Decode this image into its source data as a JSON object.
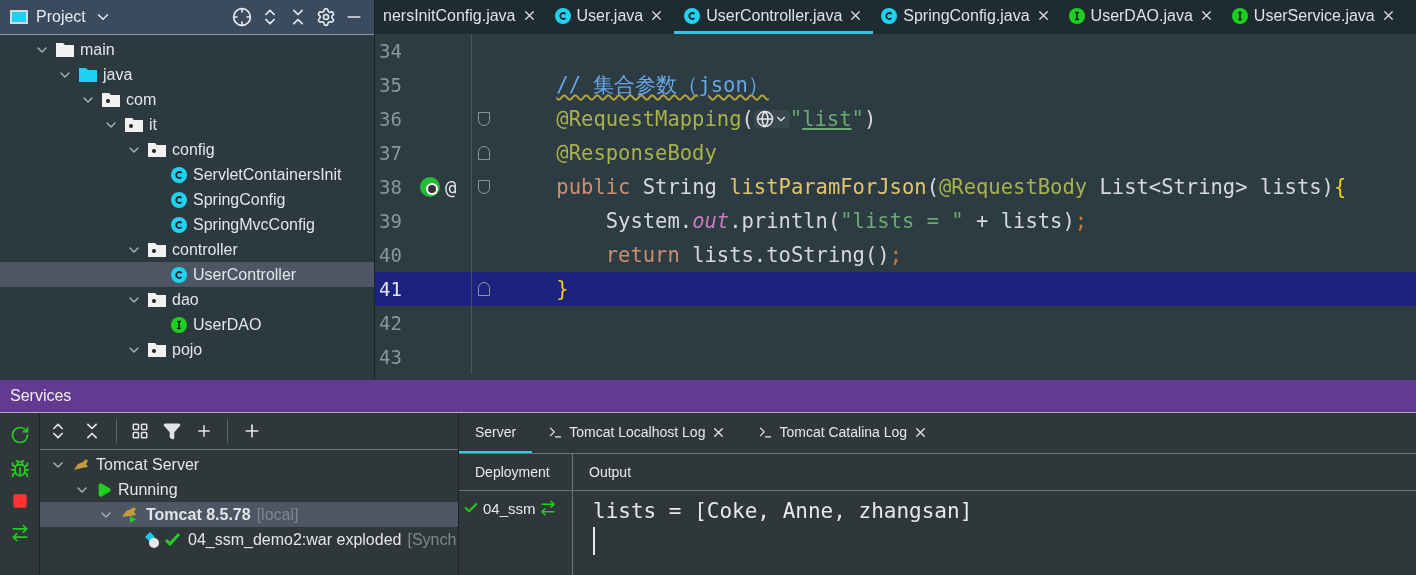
{
  "project_panel": {
    "title": "Project",
    "tree": [
      {
        "label": "main",
        "kind": "folder",
        "expanded": true,
        "selected": false,
        "children": [
          {
            "label": "java",
            "kind": "source-folder",
            "expanded": true,
            "selected": false,
            "children": [
              {
                "label": "com",
                "kind": "package",
                "expanded": true,
                "selected": false,
                "children": [
                  {
                    "label": "it",
                    "kind": "package",
                    "expanded": true,
                    "selected": false,
                    "children": [
                      {
                        "label": "config",
                        "kind": "package",
                        "expanded": true,
                        "selected": false,
                        "children": [
                          {
                            "label": "ServletContainersInit",
                            "kind": "class",
                            "selected": false
                          },
                          {
                            "label": "SpringConfig",
                            "kind": "class",
                            "selected": false
                          },
                          {
                            "label": "SpringMvcConfig",
                            "kind": "class",
                            "selected": false
                          }
                        ]
                      },
                      {
                        "label": "controller",
                        "kind": "package",
                        "expanded": true,
                        "selected": false,
                        "children": [
                          {
                            "label": "UserController",
                            "kind": "class",
                            "selected": true
                          }
                        ]
                      },
                      {
                        "label": "dao",
                        "kind": "package",
                        "expanded": true,
                        "selected": false,
                        "children": [
                          {
                            "label": "UserDAO",
                            "kind": "interface",
                            "selected": false
                          }
                        ]
                      },
                      {
                        "label": "pojo",
                        "kind": "package",
                        "expanded": true,
                        "selected": false
                      }
                    ]
                  }
                ]
              }
            ]
          }
        ]
      }
    ]
  },
  "editor_tabs": [
    {
      "label": "nersInitConfig.java",
      "kind": "none",
      "selected": false
    },
    {
      "label": "User.java",
      "kind": "class",
      "selected": false
    },
    {
      "label": "UserController.java",
      "kind": "class",
      "selected": true
    },
    {
      "label": "SpringConfig.java",
      "kind": "class",
      "selected": false
    },
    {
      "label": "UserDAO.java",
      "kind": "interface",
      "selected": false
    },
    {
      "label": "UserService.java",
      "kind": "interface",
      "selected": false
    }
  ],
  "editor": {
    "lines": [
      {
        "number": "34",
        "kind": "blank",
        "current": false,
        "fold_start": false,
        "fold_end": false
      },
      {
        "number": "35",
        "kind": "member",
        "current": false,
        "fold_start": false,
        "fold_end": false,
        "tokens": [
          {
            "text": "// 集合参数（json）",
            "kind": "comment"
          }
        ]
      },
      {
        "number": "36",
        "kind": "member",
        "current": false,
        "fold_start": true,
        "fold_end": false,
        "tokens": [
          {
            "text": "@RequestMapping",
            "kind": "annotation"
          },
          {
            "text": "(",
            "kind": "plain"
          },
          {
            "kind": "url-inlay"
          },
          {
            "text": "\"",
            "kind": "string"
          },
          {
            "text": "list",
            "kind": "string-link"
          },
          {
            "text": "\"",
            "kind": "string"
          },
          {
            "text": ")",
            "kind": "plain"
          }
        ]
      },
      {
        "number": "37",
        "kind": "member",
        "current": false,
        "fold_start": false,
        "fold_end": true,
        "tokens": [
          {
            "text": "@ResponseBody",
            "kind": "annotation"
          }
        ]
      },
      {
        "number": "38",
        "kind": "member",
        "current": false,
        "fold_start": true,
        "fold_end": false,
        "markers": true,
        "marker_text": "@",
        "tokens": [
          {
            "text": "public ",
            "kind": "keyword"
          },
          {
            "text": "String ",
            "kind": "plain"
          },
          {
            "text": "listParamForJson",
            "kind": "method"
          },
          {
            "text": "(",
            "kind": "plain"
          },
          {
            "text": "@RequestBody ",
            "kind": "annotation"
          },
          {
            "text": "List<String> lists)",
            "kind": "plain"
          },
          {
            "text": "{",
            "kind": "brace"
          }
        ]
      },
      {
        "number": "39",
        "kind": "body",
        "current": false,
        "fold_start": false,
        "fold_end": false,
        "tokens": [
          {
            "text": "System.",
            "kind": "plain"
          },
          {
            "text": "out",
            "kind": "field"
          },
          {
            "text": ".println(",
            "kind": "plain"
          },
          {
            "text": "\"lists = \"",
            "kind": "string"
          },
          {
            "text": " + lists)",
            "kind": "plain"
          },
          {
            "text": ";",
            "kind": "semicolon"
          }
        ]
      },
      {
        "number": "40",
        "kind": "body",
        "current": false,
        "fold_start": false,
        "fold_end": false,
        "tokens": [
          {
            "text": "return ",
            "kind": "keyword"
          },
          {
            "text": "lists.toString()",
            "kind": "plain"
          },
          {
            "text": ";",
            "kind": "semicolon"
          }
        ]
      },
      {
        "number": "41",
        "kind": "member",
        "current": true,
        "fold_start": false,
        "fold_end": true,
        "tokens": [
          {
            "text": "}",
            "kind": "brace"
          }
        ]
      },
      {
        "number": "42",
        "kind": "blank",
        "current": false,
        "fold_start": false,
        "fold_end": false
      },
      {
        "number": "43",
        "kind": "blank",
        "current": false,
        "fold_start": false,
        "fold_end": false
      }
    ]
  },
  "services": {
    "title": "Services",
    "tree": [
      {
        "label": "Tomcat Server",
        "kind": "tomcat",
        "expanded": true,
        "selected": false,
        "children": [
          {
            "label": "Running",
            "kind": "running",
            "expanded": true,
            "selected": false,
            "children": [
              {
                "label": "Tomcat 8.5.78",
                "suffix": "[local]",
                "kind": "tomcat-run",
                "expanded": true,
                "selected": true,
                "children": [
                  {
                    "label": "04_ssm_demo2:war exploded",
                    "suffix": "[Synch",
                    "kind": "artifact",
                    "selected": false
                  }
                ]
              }
            ]
          }
        ]
      }
    ],
    "tabs": [
      {
        "label": "Server",
        "kind": "plain",
        "selected": true,
        "closable": false
      },
      {
        "label": "Tomcat Localhost Log",
        "kind": "log",
        "selected": false,
        "closable": true
      },
      {
        "label": "Tomcat Catalina Log",
        "kind": "log",
        "selected": false,
        "closable": true
      }
    ],
    "deployment": {
      "header": "Deployment",
      "items": [
        "04_ssm"
      ]
    },
    "output": {
      "header": "Output",
      "lines": [
        "lists = [Coke, Anne, zhangsan]"
      ]
    }
  }
}
